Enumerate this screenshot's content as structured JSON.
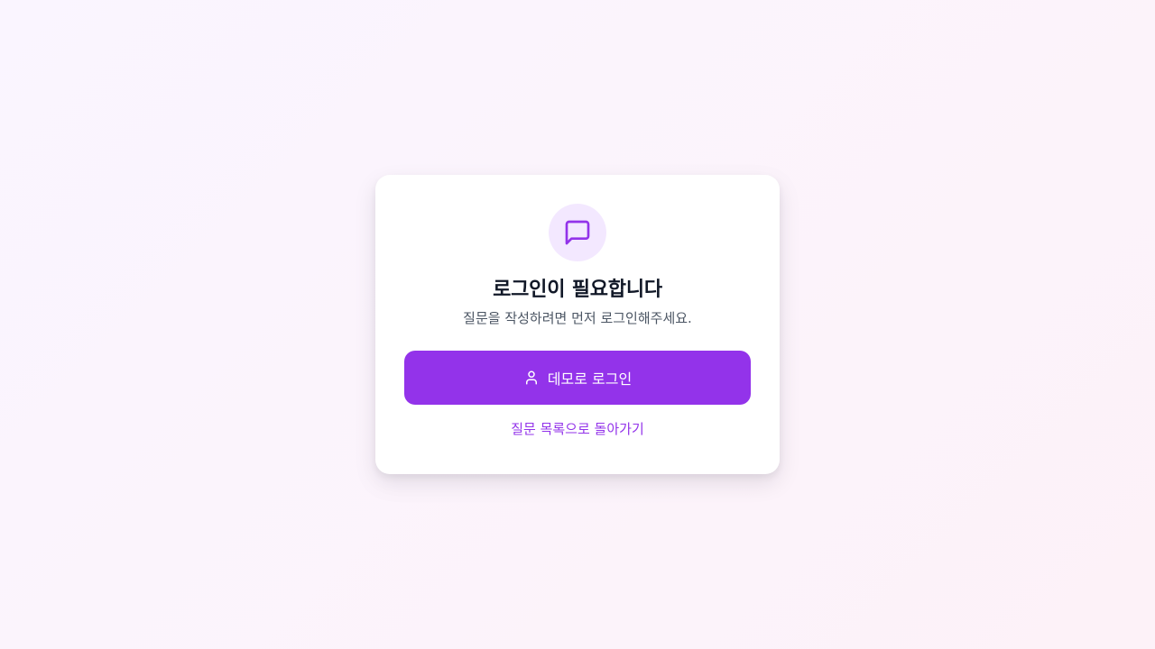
{
  "login_prompt": {
    "icon": "message-square-icon",
    "title": "로그인이 필요합니다",
    "subtitle": "질문을 작성하려면 먼저 로그인해주세요.",
    "login_button": {
      "icon": "user-icon",
      "label": "데모로 로그인"
    },
    "back_link": "질문 목록으로 돌아가기"
  },
  "colors": {
    "accent": "#9333ea",
    "icon_background": "#f3e8ff",
    "title_text": "#111827",
    "subtitle_text": "#4b5563",
    "page_background_start": "#faf5ff",
    "page_background_end": "#fdf2f8"
  }
}
